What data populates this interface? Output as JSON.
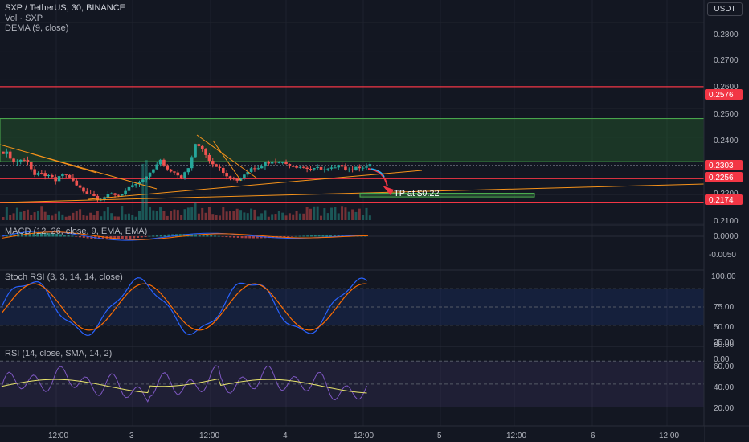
{
  "legend": {
    "symbol": "SXP / TetherUS, 30, BINANCE",
    "volume": "Vol · SXP",
    "dema": "DEMA (9, close)",
    "macd": "MACD (12, 26, close, 9, EMA, EMA)",
    "stoch": "Stoch RSI (3, 3, 14, 14, close)",
    "rsi": "RSI (14, close, SMA, 14, 2)"
  },
  "currency_button": "USDT",
  "annotation": {
    "tp_label": "TP at $0.22"
  },
  "price_axis": {
    "ticks": [
      "0.2800",
      "0.2700",
      "0.2600",
      "0.2500",
      "0.2400",
      "0.2300",
      "0.2200",
      "0.2100"
    ],
    "badges": [
      {
        "label": "0.2576",
        "color": "#f23645"
      },
      {
        "label": "0.2303",
        "color": "#f23645"
      },
      {
        "label": "0.2256",
        "color": "#f23645"
      },
      {
        "label": "0.2174",
        "color": "#f23645"
      }
    ]
  },
  "macd_axis": {
    "ticks": [
      "0.0000",
      "-0.0050"
    ]
  },
  "stoch_axis": {
    "ticks": [
      "100.00",
      "75.00",
      "50.00",
      "25.00",
      "0.00"
    ]
  },
  "rsi_axis": {
    "ticks": [
      "80.00",
      "60.00",
      "40.00",
      "20.00"
    ]
  },
  "time_axis": {
    "ticks": [
      "12:00",
      "3",
      "12:00",
      "4",
      "12:00",
      "5",
      "12:00",
      "6",
      "12:00"
    ]
  },
  "colors": {
    "background": "#131722",
    "up": "#26a69a",
    "down": "#ef5350",
    "resistance": "#f23645",
    "zone": "#2e7d32",
    "trendline": "#f7931a",
    "stoch_k": "#2962ff",
    "stoch_d": "#ff6d00",
    "rsi_line": "#7e57c2",
    "rsi_ma": "#e8e46c"
  },
  "chart_data": {
    "type": "candlestick",
    "symbol": "SXP / TetherUS",
    "interval": "30",
    "exchange": "BINANCE",
    "price_ylim": [
      0.21,
      0.285
    ],
    "levels": [
      0.2576,
      0.2256,
      0.2174
    ],
    "last_price": 0.2303,
    "supply_zone": [
      0.2315,
      0.2465
    ],
    "target_zone": [
      0.2192,
      0.2205
    ],
    "close_path": [
      0.2345,
      0.2312,
      0.2322,
      0.2318,
      0.2268,
      0.2272,
      0.2262,
      0.2248,
      0.2272,
      0.2262,
      0.2232,
      0.2212,
      0.2205,
      0.2188,
      0.2192,
      0.2202,
      0.2198,
      0.2212,
      0.2228,
      0.2242,
      0.2258,
      0.2292,
      0.2318,
      0.2288,
      0.2282,
      0.2262,
      0.2292,
      0.2372,
      0.2362,
      0.2322,
      0.2302,
      0.2282,
      0.2262,
      0.2252,
      0.2272,
      0.2292,
      0.2298,
      0.2312,
      0.2312,
      0.2318,
      0.2308,
      0.2302,
      0.2298,
      0.2292,
      0.2288,
      0.2292,
      0.2288,
      0.2292,
      0.2302,
      0.2288,
      0.2292,
      0.2298,
      0.2302
    ],
    "macd": {
      "ylim": [
        -0.008,
        0.003
      ]
    },
    "stoch_rsi": {
      "ylim": [
        0,
        100
      ],
      "bands": [
        80,
        20
      ],
      "mid": 50
    },
    "rsi": {
      "ylim": [
        15,
        82
      ],
      "bands": [
        70,
        30
      ],
      "mid": 50
    }
  }
}
